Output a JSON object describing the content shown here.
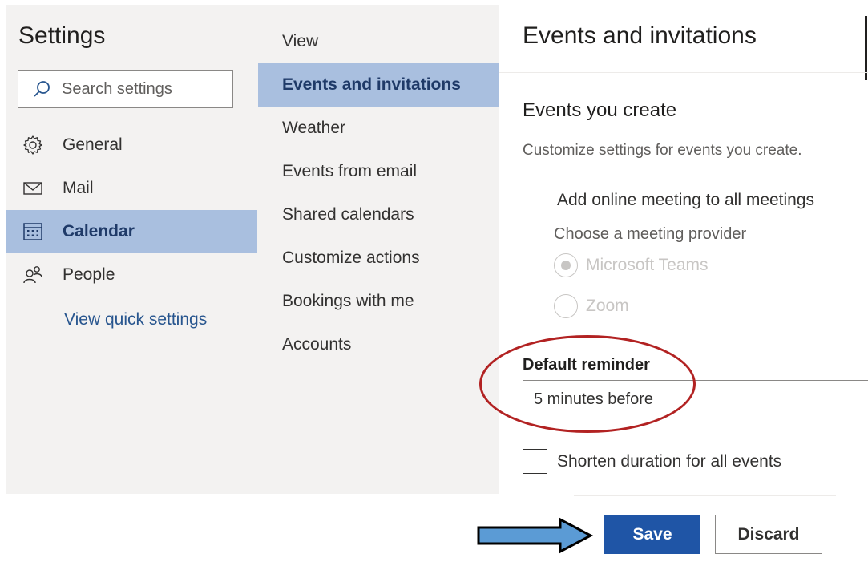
{
  "settings": {
    "title": "Settings",
    "search_placeholder": "Search settings",
    "nav": [
      {
        "label": "General",
        "icon": "gear-icon"
      },
      {
        "label": "Mail",
        "icon": "mail-icon"
      },
      {
        "label": "Calendar",
        "icon": "calendar-icon",
        "selected": true
      },
      {
        "label": "People",
        "icon": "people-icon"
      }
    ],
    "quick_settings_link": "View quick settings"
  },
  "calendar_menu": {
    "items": [
      {
        "label": "View"
      },
      {
        "label": "Events and invitations",
        "selected": true
      },
      {
        "label": "Weather"
      },
      {
        "label": "Events from email"
      },
      {
        "label": "Shared calendars"
      },
      {
        "label": "Customize actions"
      },
      {
        "label": "Bookings with me"
      },
      {
        "label": "Accounts"
      }
    ]
  },
  "panel": {
    "title": "Events and invitations",
    "section_heading": "Events you create",
    "section_description": "Customize settings for events you create.",
    "online_meeting_label": "Add online meeting to all meetings",
    "online_meeting_checked": false,
    "provider_label": "Choose a meeting provider",
    "providers": [
      {
        "label": "Microsoft Teams",
        "selected": true
      },
      {
        "label": "Zoom",
        "selected": false
      }
    ],
    "reminder_label": "Default reminder",
    "reminder_value": "5 minutes before",
    "shorten_label": "Shorten duration for all events",
    "shorten_checked": false
  },
  "footer": {
    "save_label": "Save",
    "discard_label": "Discard"
  },
  "colors": {
    "selected_bg": "#a9bfdf",
    "primary_button": "#1f55a6",
    "annotation_ellipse": "#b22222",
    "annotation_arrow": "#5b9bd5"
  }
}
